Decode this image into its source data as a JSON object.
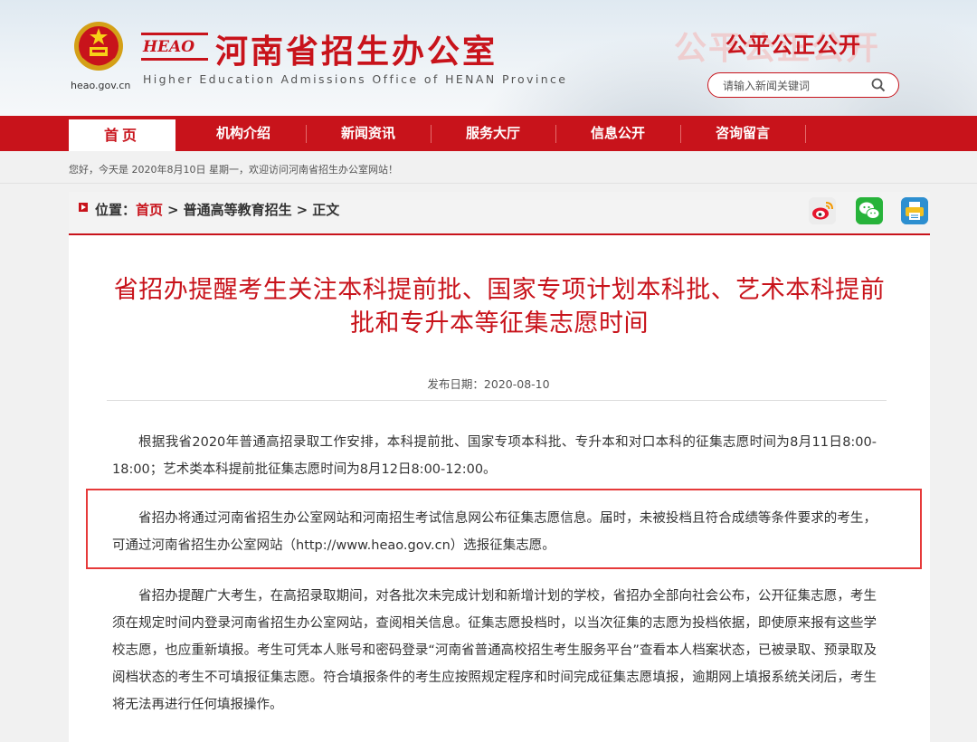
{
  "header": {
    "site_url": "heao.gov.cn",
    "logo_text": "HEAO",
    "site_title": "河南省招生办公室",
    "site_subtitle": "Higher Education Admissions Office of HENAN Province",
    "slogan": "公平公正公开",
    "search_placeholder": "请输入新闻关键词"
  },
  "nav": {
    "items": [
      {
        "label": "首页",
        "active": true
      },
      {
        "label": "机构介绍"
      },
      {
        "label": "新闻资讯"
      },
      {
        "label": "服务大厅"
      },
      {
        "label": "信息公开"
      },
      {
        "label": "咨询留言"
      }
    ]
  },
  "welcome_text": "您好，今天是 2020年8月10日 星期一，欢迎访问河南省招生办公室网站！",
  "breadcrumb": {
    "prefix": "位置：",
    "home": "首页",
    "separator": ">",
    "section": "普通高等教育招生",
    "current": "正文"
  },
  "share": [
    "weibo-icon",
    "wechat-icon",
    "print-icon"
  ],
  "article": {
    "title": "省招办提醒考生关注本科提前批、国家专项计划本科批、艺术本科提前批和专升本等征集志愿时间",
    "date_label": "发布日期：",
    "date_value": "2020-08-10",
    "paragraphs": [
      "根据我省2020年普通高招录取工作安排，本科提前批、国家专项本科批、专升本和对口本科的征集志愿时间为8月11日8:00-18:00；艺术类本科提前批征集志愿时间为8月12日8:00-12:00。",
      "省招办将通过河南省招生办公室网站和河南招生考试信息网公布征集志愿信息。届时，未被投档且符合成绩等条件要求的考生，可通过河南省招生办公室网站（http://www.heao.gov.cn）选报征集志愿。",
      "省招办提醒广大考生，在高招录取期间，对各批次未完成计划和新增计划的学校，省招办全部向社会公布，公开征集志愿，考生须在规定时间内登录河南省招生办公室网站，查阅相关信息。征集志愿投档时，以当次征集的志愿为投档依据，即使原来报有这些学校志愿，也应重新填报。考生可凭本人账号和密码登录“河南省普通高校招生考生服务平台”查看本人档案状态，已被录取、预录取及阅档状态的考生不可填报征集志愿。符合填报条件的考生应按照规定程序和时间完成征集志愿填报，逾期网上填报系统关闭后，考生将无法再进行任何填报操作。"
    ]
  },
  "colors": {
    "brand_red": "#c8131b",
    "highlight_border": "#e63a3a"
  }
}
